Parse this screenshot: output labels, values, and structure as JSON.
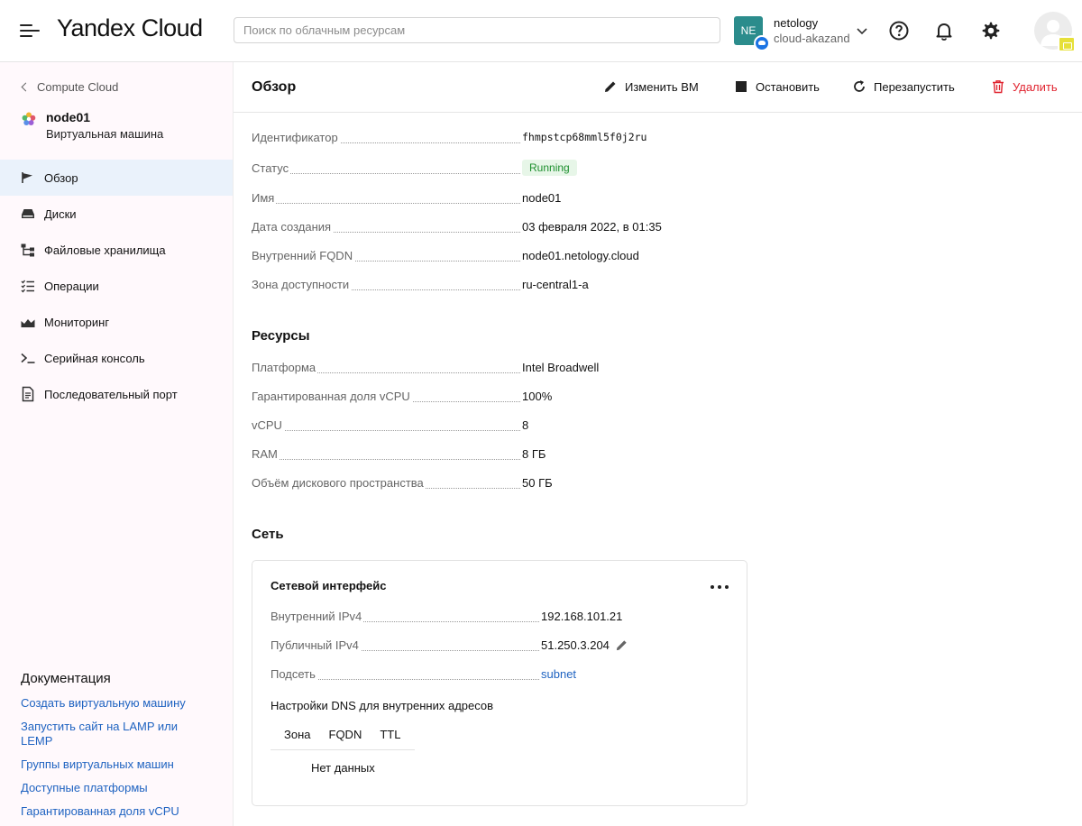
{
  "header": {
    "logo": "Yandex Cloud",
    "search_placeholder": "Поиск по облачным ресурсам",
    "cloud_initials": "NE",
    "org": "netology",
    "cloud_name": "cloud-akazand"
  },
  "sidebar": {
    "back_label": "Compute Cloud",
    "vm_name": "node01",
    "vm_type": "Виртуальная машина",
    "items": [
      {
        "label": "Обзор",
        "icon": "overview-icon",
        "active": true
      },
      {
        "label": "Диски",
        "icon": "disk-icon"
      },
      {
        "label": "Файловые хранилища",
        "icon": "file-storage-icon"
      },
      {
        "label": "Операции",
        "icon": "operations-icon"
      },
      {
        "label": "Мониторинг",
        "icon": "monitoring-icon"
      },
      {
        "label": "Серийная консоль",
        "icon": "terminal-icon"
      },
      {
        "label": "Последовательный порт",
        "icon": "document-icon"
      }
    ],
    "docs_title": "Документация",
    "docs": [
      "Создать виртуальную машину",
      "Запустить сайт на LAMP или LEMP",
      "Группы виртуальных машин",
      "Доступные платформы",
      "Гарантированная доля vCPU"
    ]
  },
  "main": {
    "title": "Обзор",
    "actions": {
      "edit": "Изменить ВМ",
      "stop": "Остановить",
      "restart": "Перезапустить",
      "delete": "Удалить"
    },
    "overview": [
      {
        "label": "Идентификатор",
        "value": "fhmpstcp68mml5f0j2ru"
      },
      {
        "label": "Статус",
        "value": "Running"
      },
      {
        "label": "Имя",
        "value": "node01"
      },
      {
        "label": "Дата создания",
        "value": "03 февраля 2022, в 01:35"
      },
      {
        "label": "Внутренний FQDN",
        "value": "node01.netology.cloud"
      },
      {
        "label": "Зона доступности",
        "value": "ru-central1-a"
      }
    ],
    "resources_title": "Ресурсы",
    "resources": [
      {
        "label": "Платформа",
        "value": "Intel Broadwell"
      },
      {
        "label": "Гарантированная доля vCPU",
        "value": "100%"
      },
      {
        "label": "vCPU",
        "value": "8"
      },
      {
        "label": "RAM",
        "value": "8 ГБ"
      },
      {
        "label": "Объём дискового пространства",
        "value": "50 ГБ"
      }
    ],
    "network_title": "Сеть",
    "network_card": {
      "title": "Сетевой интерфейс",
      "rows": [
        {
          "label": "Внутренний IPv4",
          "value": "192.168.101.21"
        },
        {
          "label": "Публичный IPv4",
          "value": "51.250.3.204"
        },
        {
          "label": "Подсеть",
          "value": "subnet"
        }
      ],
      "dns_title": "Настройки DNS для внутренних адресов",
      "dns_columns": [
        "Зона",
        "FQDN",
        "TTL"
      ],
      "dns_empty": "Нет данных"
    }
  },
  "colors": {
    "accent_link": "#1f63c1",
    "status_green": "#1d8f2e",
    "danger": "#e0232f",
    "active_nav": "#eaf2fb"
  }
}
